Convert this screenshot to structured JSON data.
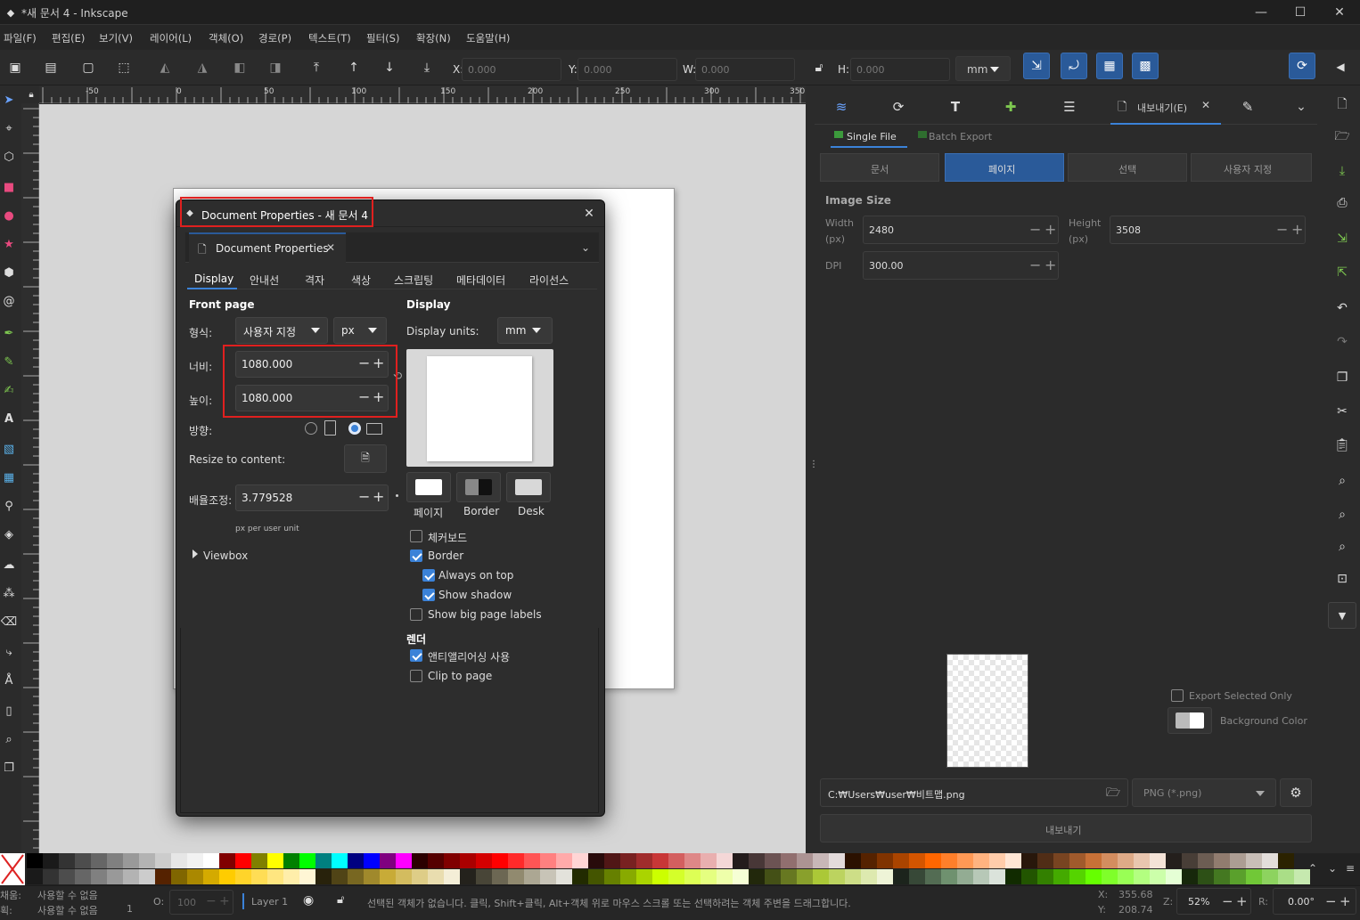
{
  "window": {
    "title": "*새 문서 4 - Inkscape"
  },
  "menu": [
    "파일(F)",
    "편집(E)",
    "보기(V)",
    "레이어(L)",
    "객체(O)",
    "경로(P)",
    "텍스트(T)",
    "필터(S)",
    "확장(N)",
    "도움말(H)"
  ],
  "toolbar": {
    "x_label": "X:",
    "x_value": "0.000",
    "y_label": "Y:",
    "y_value": "0.000",
    "w_label": "W:",
    "w_value": "0.000",
    "h_label": "H:",
    "h_value": "0.000",
    "unit": "mm"
  },
  "ruler": {
    "marks": [
      "-50",
      "0",
      "50",
      "100",
      "150",
      "200",
      "250",
      "300",
      "350"
    ],
    "vmarks": [
      "-50",
      "0",
      "50",
      "100",
      "150",
      "200",
      "250",
      "300",
      "350"
    ]
  },
  "dialog": {
    "title": "Document Properties - 새 문서 4",
    "tab_label": "Document Properties",
    "subtabs": [
      "Display",
      "안내선",
      "격자",
      "색상",
      "스크립팅",
      "메타데이터",
      "라이선스"
    ],
    "front_page": {
      "heading": "Front page",
      "format_label": "형식:",
      "format_value": "사용자 지정",
      "unit_value": "px",
      "width_label": "너비:",
      "width_value": "1080.000",
      "height_label": "높이:",
      "height_value": "1080.000",
      "orientation_label": "방향:",
      "resize_label": "Resize to content:",
      "scale_label": "배율조정:",
      "scale_value": "3.779528",
      "scale_hint": "px per user unit",
      "viewbox_label": "Viewbox"
    },
    "display": {
      "heading": "Display",
      "units_label": "Display units:",
      "units_value": "mm",
      "swatch_labels": [
        "페이지",
        "Border",
        "Desk"
      ],
      "checkerboard": "체커보드",
      "border": "Border",
      "always_on_top": "Always on top",
      "show_shadow": "Show shadow",
      "big_labels": "Show big page labels",
      "render_heading": "렌더",
      "antialias": "앤티앨리어싱 사용",
      "clip": "Clip to page"
    }
  },
  "export_panel": {
    "tab_label": "내보내기(E)",
    "modes": [
      "Single File",
      "Batch Export"
    ],
    "targets": [
      "문서",
      "페이지",
      "선택",
      "사용자 지정"
    ],
    "image_size": "Image Size",
    "width_label": "Width",
    "width_unit": "(px)",
    "width_value": "2480",
    "height_label": "Height",
    "height_unit": "(px)",
    "height_value": "3508",
    "dpi_label": "DPI",
    "dpi_value": "300.00",
    "export_selected": "Export Selected Only",
    "bg_color": "Background Color",
    "filename": "C:₩Users₩user₩비트맵.png",
    "format": "PNG (*.png)",
    "export_button": "내보내기"
  },
  "status": {
    "fill_label": "채움:",
    "fill_value": "사용할 수 없음",
    "stroke_label": "획:",
    "stroke_value": "사용할 수 없음",
    "stroke_width": "1",
    "opacity_label": "O:",
    "opacity_value": "100",
    "layer": "Layer 1",
    "message": "선택된 객체가 없습니다. 클릭, Shift+클릭, Alt+객체 위로 마우스 스크롤 또는 선택하려는 객체 주변을 드래그합니다.",
    "x_label": "X:",
    "x_value": "355.68",
    "y_label": "Y:",
    "y_value": "208.74",
    "zoom_label": "Z:",
    "zoom_value": "52%",
    "rot_label": "R:",
    "rot_value": "0.00°"
  },
  "colors": {
    "accent": "#2a5a99",
    "highlight": "#e0201f"
  }
}
